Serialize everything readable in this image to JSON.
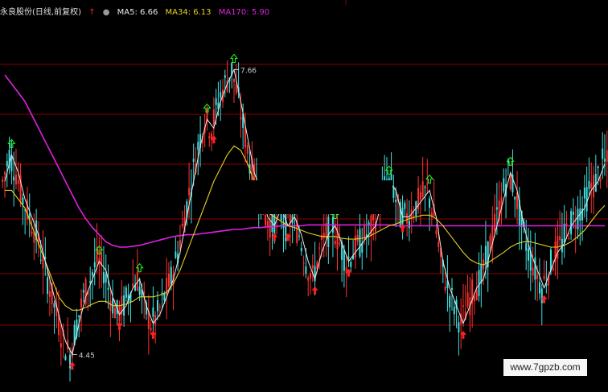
{
  "header": {
    "title": "永良股份(日线,前复权)",
    "ma5_label": "MA5: 6.66",
    "ma34_label": "MA34: 6.13",
    "ma170_label": "MA170: 5.90",
    "ma5_color": "#e8e8e8",
    "ma34_color": "#e6d020",
    "ma170_color": "#e020e0",
    "up_arrow_icon": "red-up-arrow-icon",
    "dot_icon": "gray-dot-icon"
  },
  "watermark": "www.7gpzb.com",
  "colors": {
    "background": "#000000",
    "gridline": "#8b0000",
    "up_candle": "#ff3030",
    "down_candle": "#40e0e0",
    "buy_signal": "#ff2020",
    "sell_signal": "#20ff20"
  },
  "chart_data": {
    "type": "candlestick",
    "title": "永良股份(日线,前复权)",
    "ylim": [
      4.2,
      7.9
    ],
    "grid": true,
    "annotations": [
      {
        "label": "7.66",
        "value": 7.66,
        "type": "high"
      },
      {
        "label": "4.45",
        "value": 4.45,
        "type": "low"
      }
    ],
    "series": [
      {
        "name": "MA5",
        "last": 6.66
      },
      {
        "name": "MA34",
        "last": 6.13
      },
      {
        "name": "MA170",
        "last": 5.9
      }
    ],
    "price_trend": [
      6.4,
      6.7,
      6.5,
      6.2,
      6.0,
      5.8,
      5.5,
      5.2,
      4.9,
      4.6,
      4.45,
      4.8,
      5.1,
      5.3,
      5.5,
      5.4,
      5.1,
      4.9,
      5.0,
      5.2,
      5.3,
      5.0,
      4.8,
      4.9,
      5.1,
      5.3,
      5.6,
      6.0,
      6.4,
      6.8,
      7.1,
      7.0,
      7.3,
      7.5,
      7.66,
      7.3,
      6.9,
      6.5,
      6.3,
      6.0,
      5.9,
      6.1,
      5.9,
      6.0,
      5.8,
      5.5,
      5.3,
      5.6,
      5.8,
      5.9,
      5.7,
      5.5,
      5.6,
      5.7,
      5.8,
      5.9,
      6.2,
      6.4,
      6.3,
      6.0,
      6.0,
      6.1,
      6.2,
      6.3,
      6.0,
      5.5,
      5.2,
      5.0,
      4.8,
      5.0,
      5.2,
      5.3,
      5.6,
      5.9,
      6.2,
      6.5,
      6.3,
      5.9,
      5.6,
      5.4,
      5.2,
      5.4,
      5.6,
      5.7,
      5.9,
      6.0,
      6.1,
      6.3,
      6.4,
      6.6
    ],
    "ma34_trend": [
      6.3,
      6.3,
      6.2,
      6.1,
      5.9,
      5.7,
      5.5,
      5.3,
      5.1,
      5.0,
      4.95,
      4.95,
      4.98,
      5.02,
      5.05,
      5.05,
      5.0,
      5.0,
      5.02,
      5.05,
      5.1,
      5.1,
      5.1,
      5.12,
      5.15,
      5.25,
      5.4,
      5.6,
      5.8,
      6.0,
      6.2,
      6.4,
      6.55,
      6.7,
      6.8,
      6.75,
      6.6,
      6.4,
      6.2,
      6.05,
      6.0,
      5.95,
      5.9,
      5.88,
      5.85,
      5.82,
      5.8,
      5.78,
      5.78,
      5.78,
      5.76,
      5.75,
      5.75,
      5.76,
      5.78,
      5.82,
      5.86,
      5.9,
      5.92,
      5.95,
      5.98,
      6.0,
      6.02,
      6.02,
      5.98,
      5.9,
      5.8,
      5.7,
      5.6,
      5.52,
      5.48,
      5.46,
      5.5,
      5.55,
      5.6,
      5.66,
      5.7,
      5.72,
      5.72,
      5.7,
      5.68,
      5.66,
      5.66,
      5.68,
      5.72,
      5.78,
      5.85,
      5.95,
      6.05,
      6.13
    ],
    "ma170_trend": [
      7.6,
      7.5,
      7.4,
      7.3,
      7.15,
      7.0,
      6.85,
      6.7,
      6.55,
      6.4,
      6.25,
      6.1,
      5.98,
      5.88,
      5.8,
      5.72,
      5.68,
      5.66,
      5.66,
      5.67,
      5.68,
      5.7,
      5.72,
      5.74,
      5.76,
      5.78,
      5.79,
      5.8,
      5.8,
      5.81,
      5.82,
      5.83,
      5.84,
      5.85,
      5.86,
      5.86,
      5.87,
      5.88,
      5.88,
      5.89,
      5.89,
      5.9,
      5.9,
      5.9,
      5.9,
      5.91,
      5.91,
      5.91,
      5.91,
      5.91,
      5.91,
      5.91,
      5.91,
      5.91,
      5.91,
      5.91,
      5.91,
      5.91,
      5.9,
      5.9,
      5.9,
      5.9,
      5.9,
      5.9,
      5.9,
      5.9,
      5.9,
      5.9,
      5.9,
      5.9,
      5.9,
      5.9,
      5.9,
      5.9,
      5.9,
      5.9,
      5.9,
      5.9,
      5.9,
      5.9,
      5.9,
      5.9,
      5.9,
      5.9,
      5.9,
      5.9,
      5.9,
      5.9,
      5.9,
      5.9
    ]
  }
}
